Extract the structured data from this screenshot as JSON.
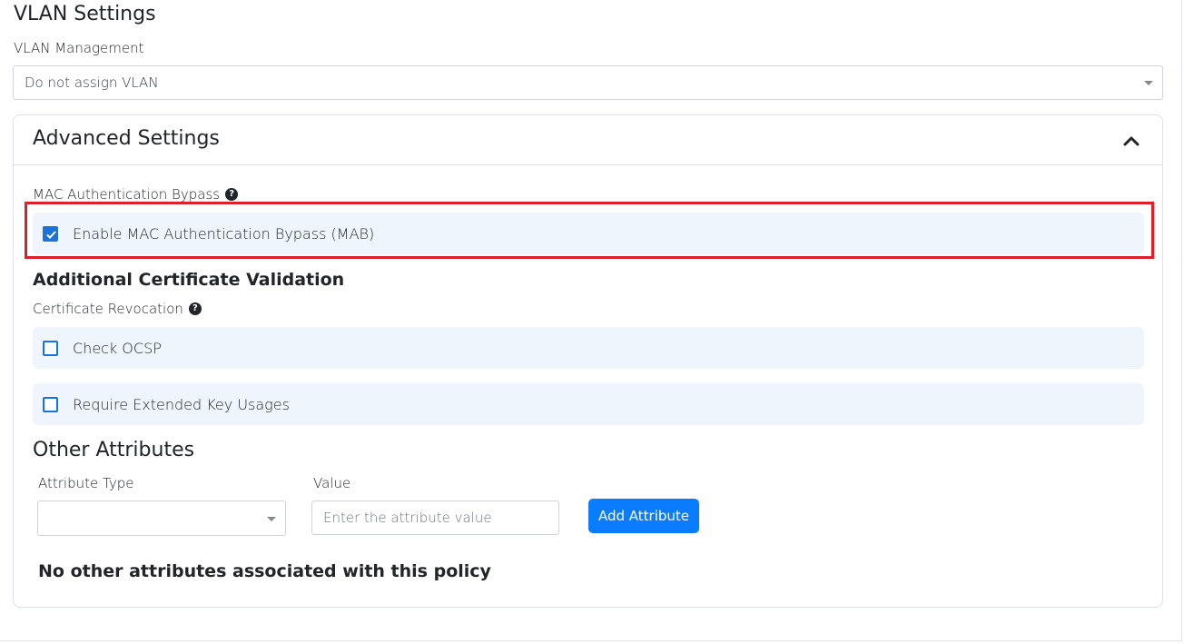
{
  "vlan": {
    "title": "VLAN Settings",
    "management_label": "VLAN Management",
    "management_value": "Do not assign VLAN"
  },
  "advanced": {
    "title": "Advanced Settings",
    "mab": {
      "label": "MAC Authentication Bypass",
      "checkbox_label": "Enable MAC Authentication Bypass (MAB)",
      "checked": true
    },
    "cert_validation": {
      "heading": "Additional Certificate Validation",
      "revocation_label": "Certificate Revocation",
      "options": [
        {
          "label": "Check OCSP",
          "checked": false
        },
        {
          "label": "Require Extended Key Usages",
          "checked": false
        }
      ]
    },
    "other_attributes": {
      "heading": "Other Attributes",
      "type_label": "Attribute Type",
      "type_value": "",
      "value_label": "Value",
      "value_placeholder": "Enter the attribute value",
      "add_button": "Add Attribute",
      "empty_message": "No other attributes associated with this policy"
    }
  },
  "colors": {
    "accent": "#1a73d9",
    "button": "#0a7cff",
    "highlight": "#dd1f2c",
    "row_bg": "#eef5fc"
  }
}
